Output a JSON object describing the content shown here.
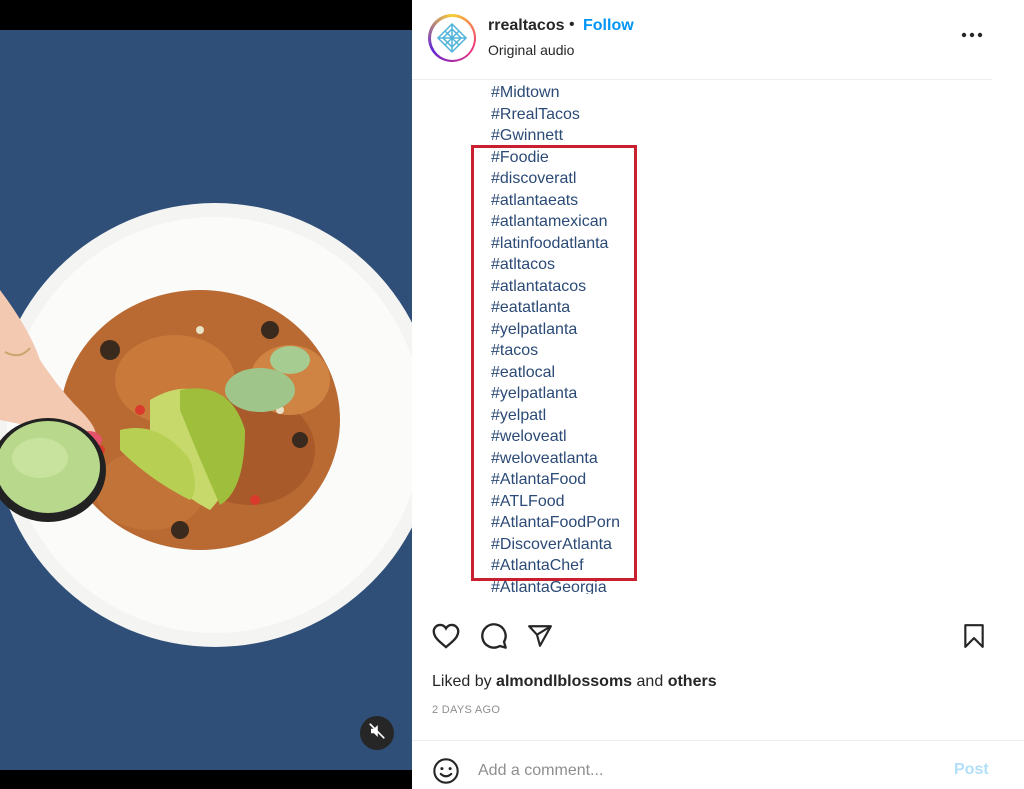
{
  "post": {
    "username": "rrealtacos",
    "separator": "•",
    "follow_label": "Follow",
    "audio": "Original audio"
  },
  "caption": {
    "hashtags": [
      "#Midtown",
      "#RrealTacos",
      "#Gwinnett",
      "#Foodie",
      "#discoveratl",
      "#atlantaeats",
      "#atlantamexican",
      "#latinfoodatlanta",
      "#atltacos",
      "#atlantatacos",
      "#eatatlanta",
      "#yelpatlanta",
      "#tacos",
      "#eatlocal",
      "#yelpatlanta",
      "#yelpatl",
      "#weloveatl",
      "#weloveatlanta",
      "#AtlantaFood",
      "#ATLFood",
      "#AtlantaFoodPorn",
      "#DiscoverAtlanta",
      "#AtlantaChef",
      "#AtlantaGeorgia"
    ]
  },
  "likes": {
    "prefix": "Liked by",
    "user": "almondlblossoms",
    "middle": "and",
    "others": "others"
  },
  "date": "2 DAYS AGO",
  "comment": {
    "placeholder": "Add a comment...",
    "post_label": "Post"
  },
  "colors": {
    "follow": "#0095f6",
    "hashtag": "#2b4a76",
    "highlight_box": "#c8202f",
    "post_disabled": "#b2dffc",
    "media_background": "#2f4f78"
  },
  "icons": {
    "like": "heart-icon",
    "comment": "comment-icon",
    "share": "paper-plane-icon",
    "save": "bookmark-icon",
    "more": "more-options-icon",
    "mute": "speaker-muted-icon",
    "emoji": "emoji-icon"
  }
}
